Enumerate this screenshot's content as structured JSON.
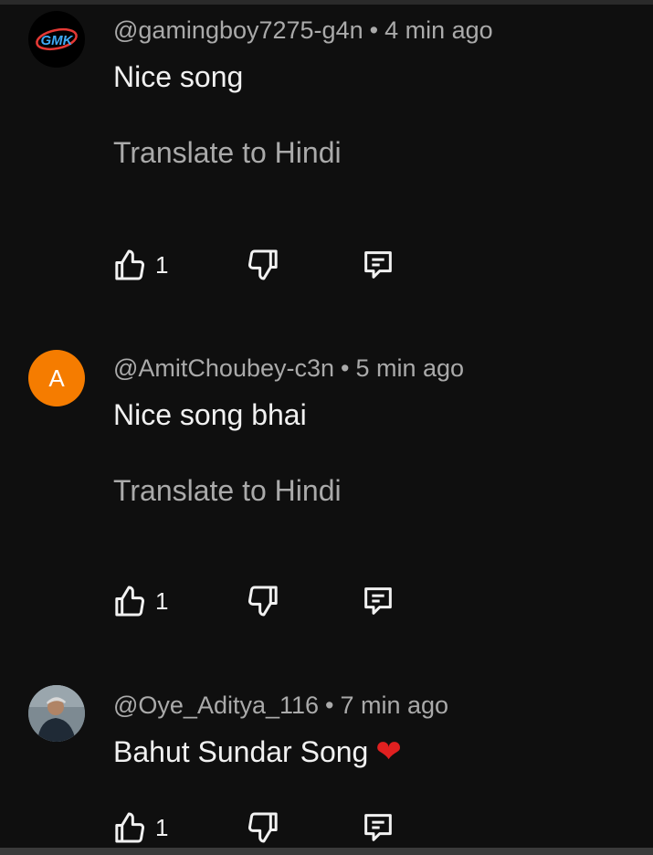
{
  "comments": [
    {
      "avatar_text": "GMK",
      "handle": "@gamingboy7275-g4n",
      "time": "4 min ago",
      "text": "Nice song",
      "translate_label": "Translate to Hindi",
      "likes": "1"
    },
    {
      "avatar_text": "A",
      "handle": "@AmitChoubey-c3n",
      "time": "5 min ago",
      "text": "Nice song bhai",
      "translate_label": "Translate to Hindi",
      "likes": "1"
    },
    {
      "avatar_text": "",
      "handle": "@Oye_Aditya_116",
      "time": "7 min ago",
      "text": "Bahut Sundar Song",
      "emoji": "❤",
      "likes": "1"
    }
  ],
  "separator": "•",
  "colors": {
    "background": "#0f0f0f",
    "primary_text": "#f1f1f1",
    "secondary_text": "#aaaaaa",
    "letter_avatar": "#f57c00",
    "heart": "#e02020"
  },
  "icons": [
    "like-icon",
    "dislike-icon",
    "reply-icon"
  ]
}
